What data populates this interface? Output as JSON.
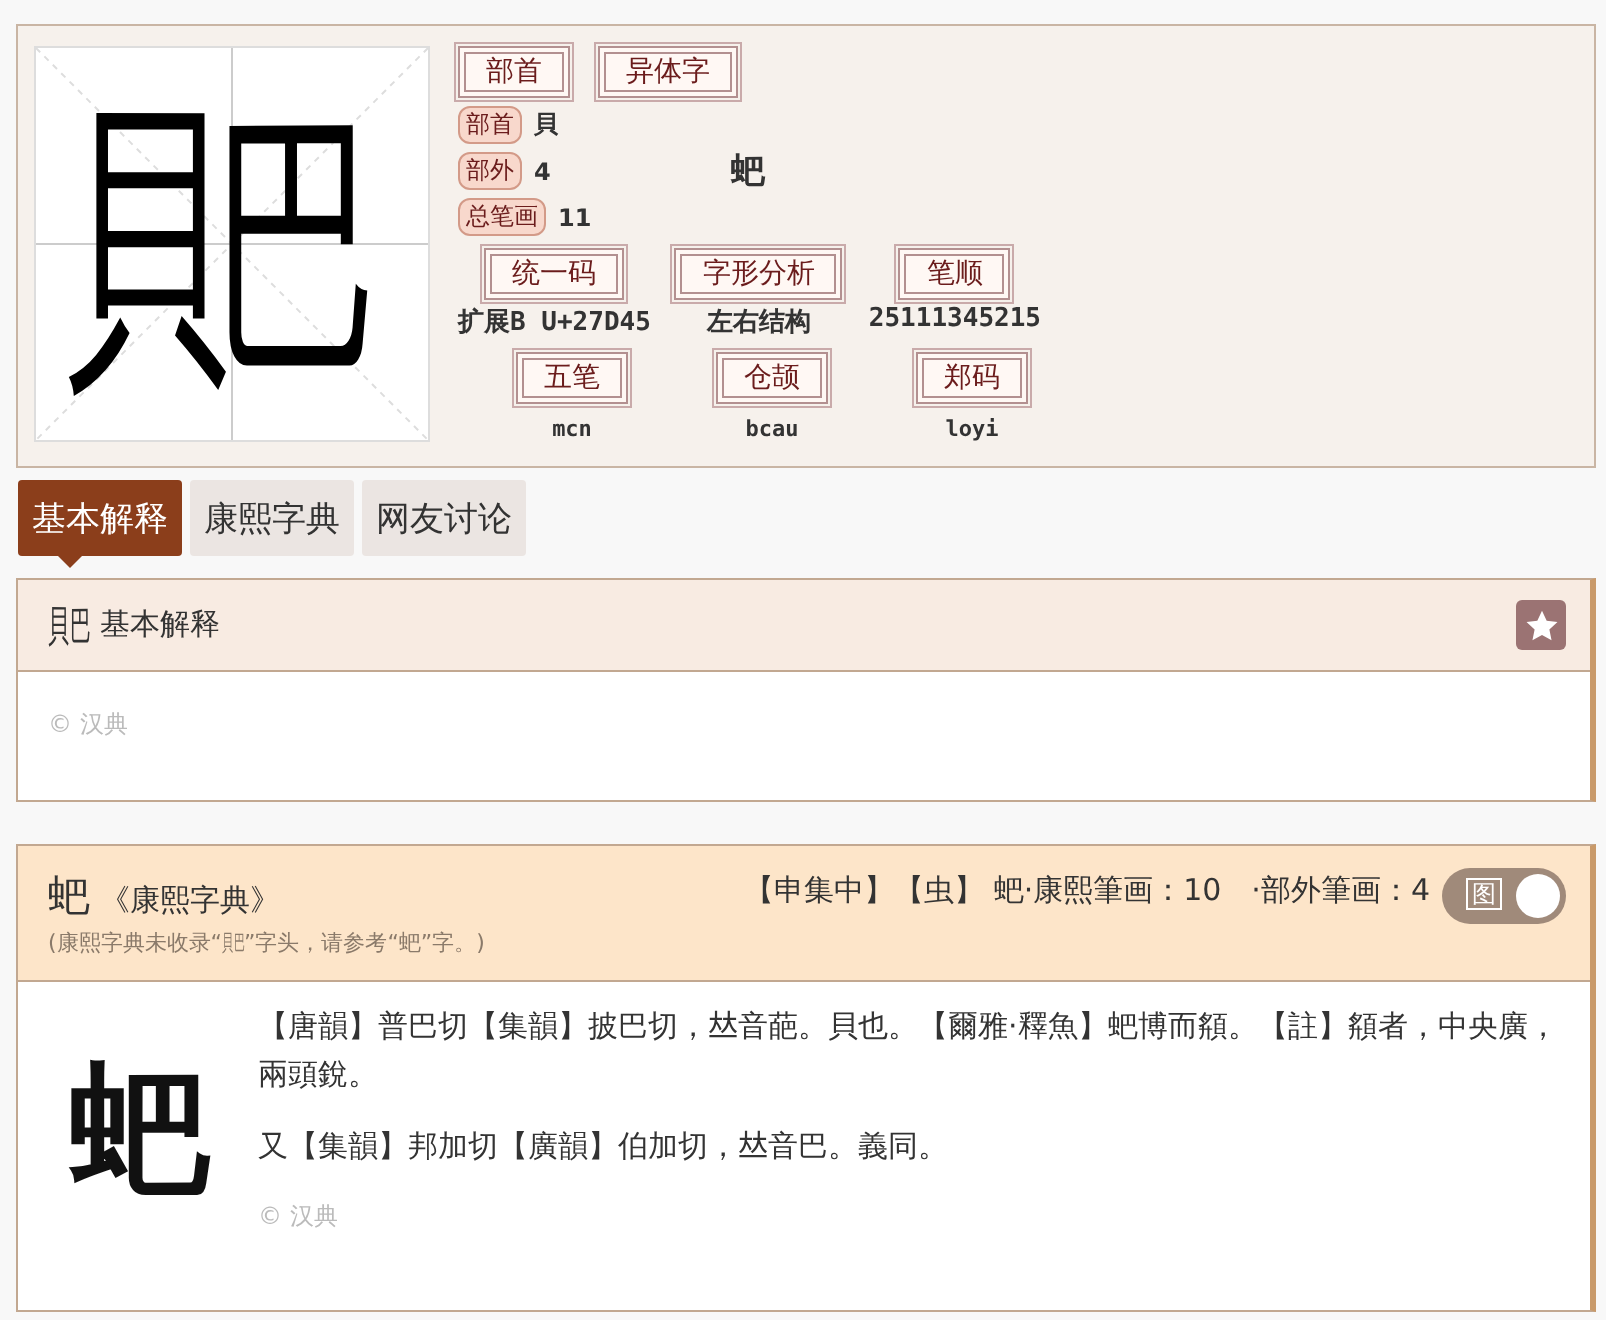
{
  "character_parts": [
    "貝",
    "巴"
  ],
  "top_buttons": [
    "部首",
    "异体字"
  ],
  "info": [
    {
      "label": "部首",
      "value": "貝"
    },
    {
      "label": "部外",
      "value": "4"
    },
    {
      "label": "总笔画",
      "value": "11"
    }
  ],
  "related_char": "蚆",
  "codes_row1": [
    {
      "label": "统一码",
      "value": "扩展B U+27D45"
    },
    {
      "label": "字形分析",
      "value": "左右结构"
    },
    {
      "label": "笔顺",
      "value": "25111345215"
    }
  ],
  "codes_row2": [
    {
      "label": "五笔",
      "value": "mcn"
    },
    {
      "label": "仓颉",
      "value": "bcau"
    },
    {
      "label": "郑码",
      "value": "loyi"
    }
  ],
  "tabs": [
    {
      "label": "基本解释",
      "selected": true
    },
    {
      "label": "康熙字典",
      "selected": false
    },
    {
      "label": "网友讨论",
      "selected": false
    }
  ],
  "basic": {
    "char_parts": [
      "貝",
      "巴"
    ],
    "title": "基本解释",
    "copyright": "© 汉典"
  },
  "kangxi": {
    "char": "蚆",
    "title": "《康熙字典》",
    "note": {
      "before": "(康熙字典未收录“",
      "char_parts": [
        "貝",
        "巴"
      ],
      "after": "”字头，请参考“蚆”字。)"
    },
    "meta": "【申集中】【虫】 蚆·康熙筆画：10　·部外筆画：4",
    "toggle_label": "图",
    "toggle_on": true,
    "big_char": "蚆",
    "paragraphs": [
      "【唐韻】普巴切【集韻】披巴切，𠀤音葩。貝也。【爾雅·釋魚】蚆博而頯。【註】頯者，中央廣，兩頭銳。",
      "又【集韻】邦加切【廣韻】伯加切，𠀤音巴。義同。"
    ],
    "copyright": "© 汉典"
  }
}
